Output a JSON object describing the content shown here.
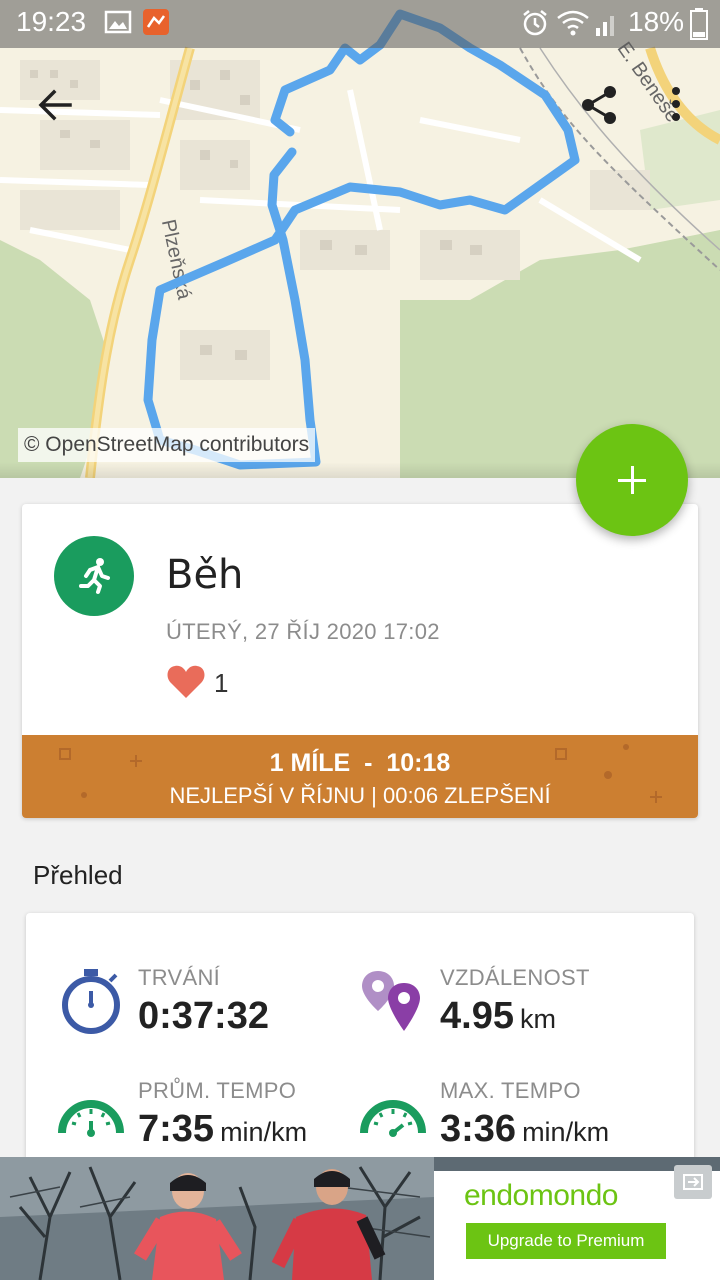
{
  "status_bar": {
    "time": "19:23",
    "battery": "18%",
    "icons": [
      "gallery-icon",
      "app-notification-icon",
      "alarm-icon",
      "wifi-icon",
      "signal-icon",
      "battery-icon"
    ]
  },
  "map": {
    "credit": "© OpenStreetMap contributors",
    "street_labels": [
      "Plzeňská",
      "E. Beneše"
    ],
    "route_color": "#5aa6ec"
  },
  "toolbar": {
    "back_icon": "arrow-back-icon",
    "share_icon": "share-icon",
    "more_icon": "more-vert-icon"
  },
  "fab": {
    "icon": "plus-icon",
    "color": "#6cc413"
  },
  "workout": {
    "sport": "Běh",
    "date": "ÚTERÝ, 27 ŘÍJ 2020 17:02",
    "likes": "1",
    "sport_color": "#1a9c5e",
    "achievement": {
      "line1_distance": "1 MÍLE",
      "line1_sep": "-",
      "line1_time": "10:18",
      "line2_best": "NEJLEPŠÍ V ŘÍJNU",
      "line2_sep": "|",
      "line2_improve": "00:06 ZLEPŠENÍ",
      "color": "#cc7f31"
    }
  },
  "overview": {
    "title": "Přehled",
    "stats": [
      {
        "label": "TRVÁNÍ",
        "value": "0:37:32",
        "unit": "",
        "icon": "stopwatch-icon"
      },
      {
        "label": "VZDÁLENOST",
        "value": "4.95",
        "unit": "km",
        "icon": "location-pins-icon"
      },
      {
        "label": "PRŮM. TEMPO",
        "value": "7:35",
        "unit": "min/km",
        "icon": "speedometer-icon"
      },
      {
        "label": "MAX. TEMPO",
        "value": "3:36",
        "unit": "min/km",
        "icon": "speedometer-max-icon"
      }
    ]
  },
  "ad": {
    "brand": "endomondo",
    "cta": "Upgrade to Premium"
  }
}
